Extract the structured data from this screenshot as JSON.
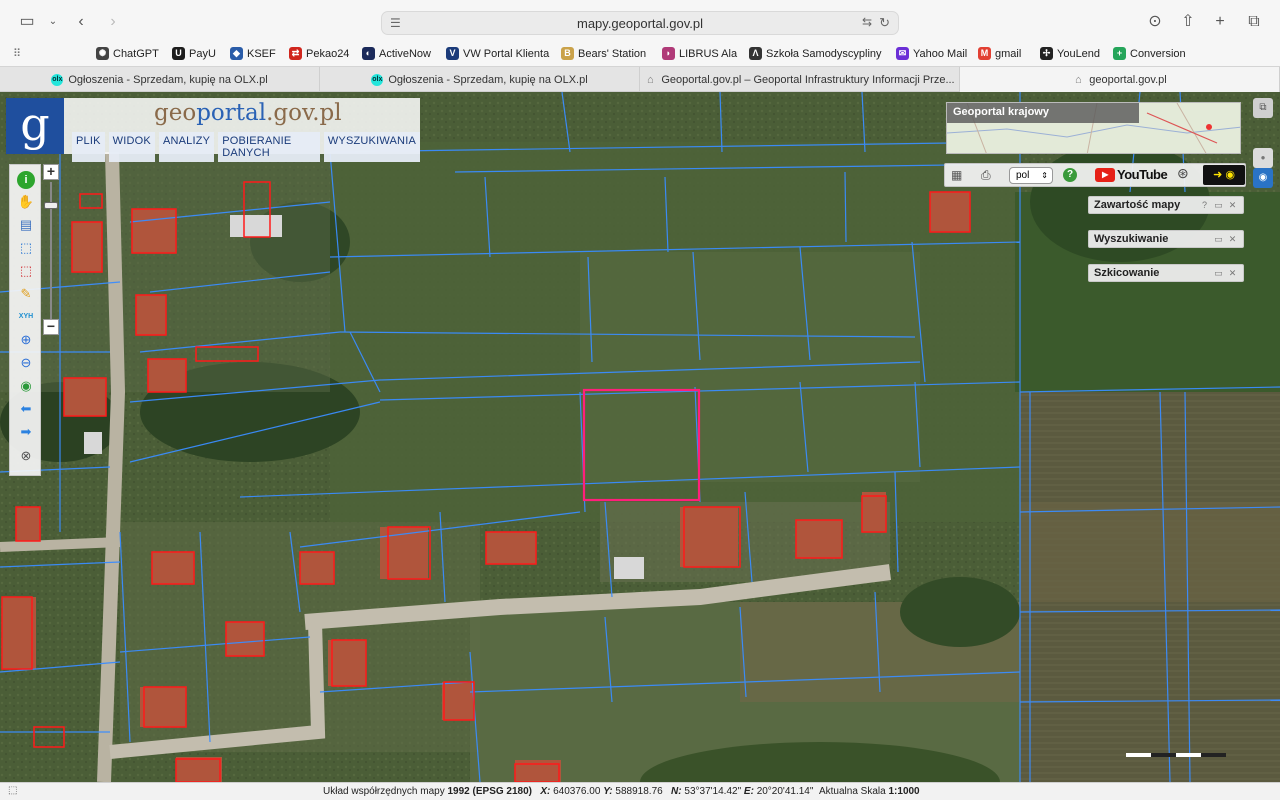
{
  "browser": {
    "url": "mapy.geoportal.gov.pl",
    "bookmarks": [
      {
        "label": "ChatGPT",
        "color": "#444444",
        "glyph": "✺"
      },
      {
        "label": "PayU",
        "color": "#1d1d1d",
        "glyph": "U"
      },
      {
        "label": "KSEF",
        "color": "#2a5ca8",
        "glyph": "◆"
      },
      {
        "label": "Pekao24",
        "color": "#d0261d",
        "glyph": "⇄"
      },
      {
        "label": "ActiveNow",
        "color": "#1b2a5a",
        "glyph": "◐"
      },
      {
        "label": "VW Portal Klienta",
        "color": "#1b3b7a",
        "glyph": "V"
      },
      {
        "label": "Bears' Station",
        "color": "#caa24a",
        "glyph": "B"
      },
      {
        "label": "LIBRUS  Ala",
        "color": "#b03a78",
        "glyph": "◗"
      },
      {
        "label": "Szkoła Samodyscypliny",
        "color": "#333333",
        "glyph": "Λ"
      },
      {
        "label": "Yahoo Mail",
        "color": "#6b2fd6",
        "glyph": "✉"
      },
      {
        "label": "gmail",
        "color": "#e24033",
        "glyph": "M"
      },
      {
        "label": "YouLend",
        "color": "#222222",
        "glyph": "✢"
      },
      {
        "label": "Conversion",
        "color": "#25a55a",
        "glyph": "+"
      }
    ],
    "tabs": [
      {
        "label": "Ogłoszenia - Sprzedam, kupię na OLX.pl",
        "fav": "olx"
      },
      {
        "label": "Ogłoszenia - Sprzedam, kupię na OLX.pl",
        "fav": "olx"
      },
      {
        "label": "Geoportal.gov.pl – Geoportal Infrastruktury Informacji Prze...",
        "fav": "gp"
      },
      {
        "label": "geoportal.gov.pl",
        "fav": "gp"
      }
    ]
  },
  "geoportal": {
    "logo_prefix": "geo",
    "logo_main": "portal",
    "logo_suffix": ".gov.pl",
    "logo_letter": "g",
    "menu": [
      "PLIK",
      "WIDOK",
      "ANALIZY",
      "POBIERANIE DANYCH",
      "WYSZUKIWANIA"
    ],
    "overview_title": "Geoportal krajowy",
    "language": "pol",
    "youtube_label": "YouTube",
    "panels": [
      "Zawartość mapy",
      "Wyszukiwanie",
      "Szkicowanie"
    ],
    "status": {
      "prefix": "Układ współrzędnych mapy",
      "system": "1992 (EPSG 2180)",
      "x_label": "X:",
      "x_value": "640376.00",
      "y_label": "Y:",
      "y_value": "588918.76",
      "n_label": "N:",
      "n_value": "53°37'14.42\"",
      "e_label": "E:",
      "e_value": "20°20'41.14\"",
      "scale_label": "Aktualna Skala",
      "scale_value": "1:1000"
    }
  },
  "colors": {
    "parcel_line": "#2f7fff",
    "building_outline": "#ff1a1a",
    "selected_parcel": "#ff1f7a",
    "logo_blue": "#1f4f9e"
  }
}
